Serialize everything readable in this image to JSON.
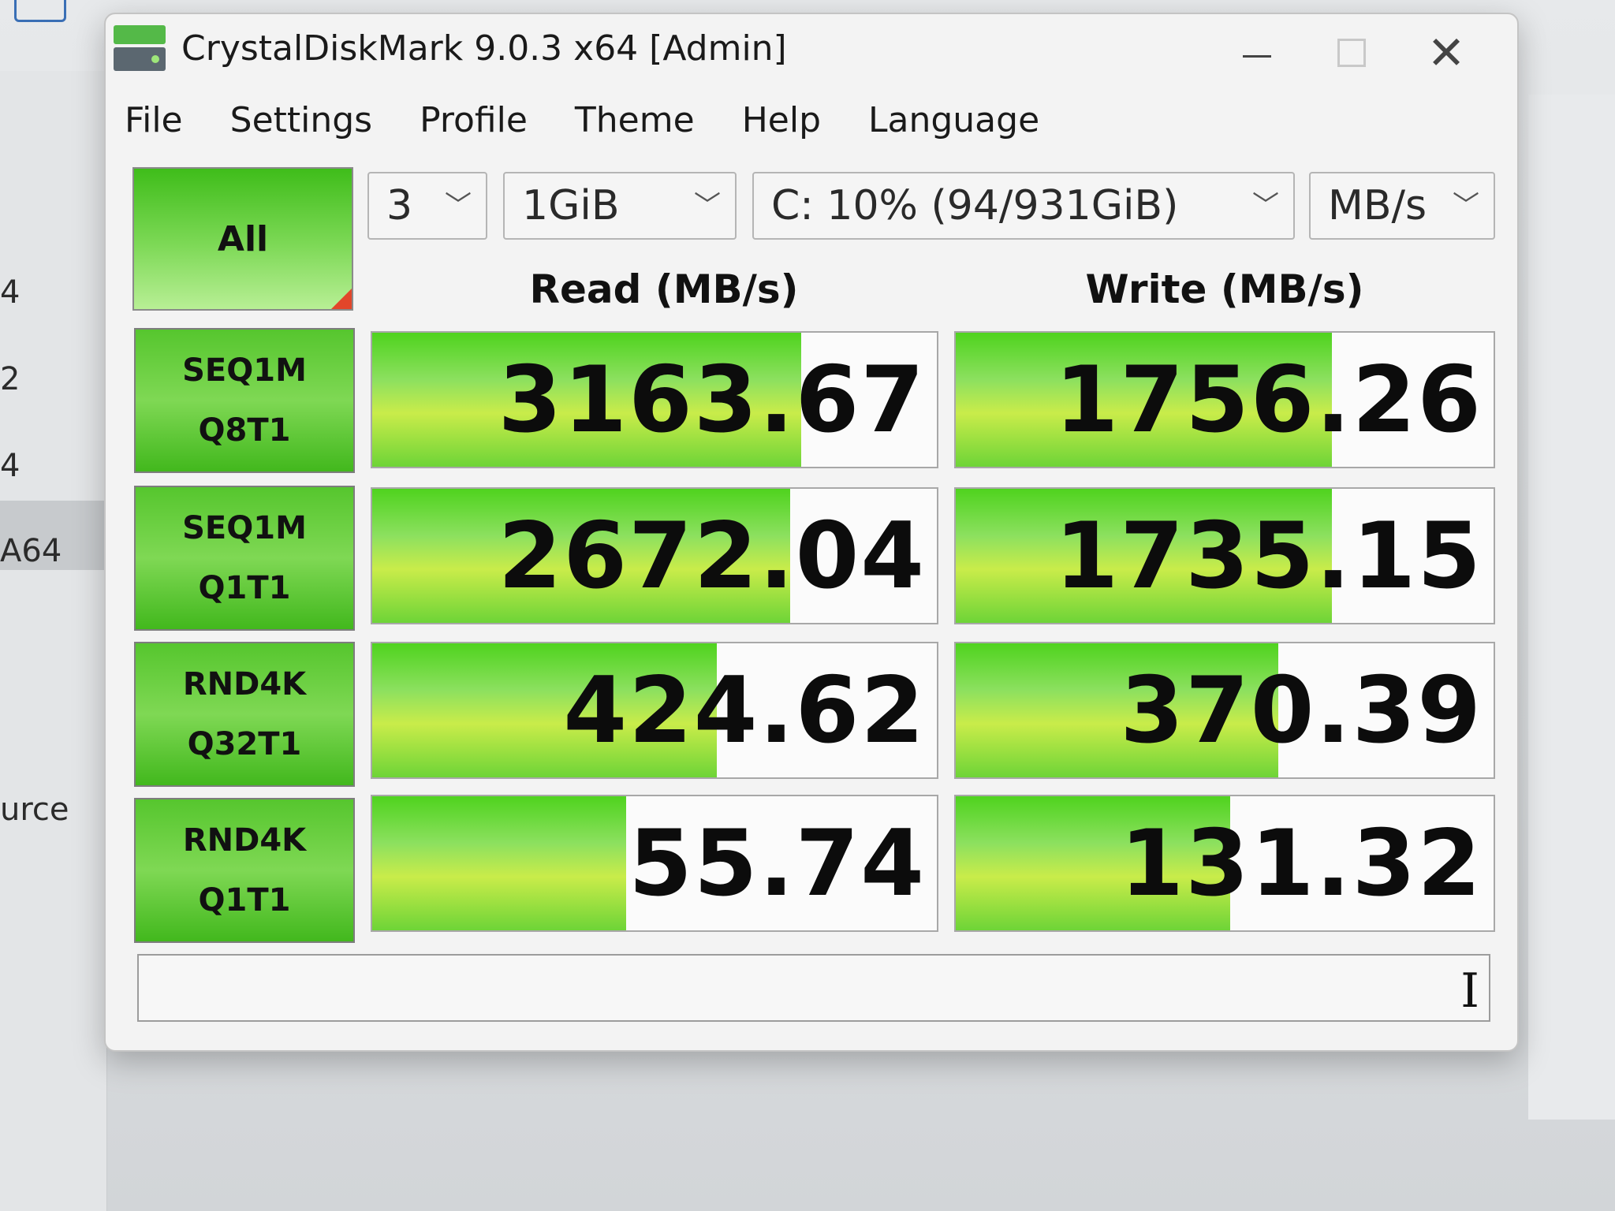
{
  "window": {
    "title": "CrystalDiskMark 9.0.3 x64 [Admin]"
  },
  "menu": [
    "File",
    "Settings",
    "Profile",
    "Theme",
    "Help",
    "Language"
  ],
  "controls": {
    "all_label": "All",
    "count": "3",
    "size": "1GiB",
    "drive": "C: 10% (94/931GiB)",
    "unit": "MB/s"
  },
  "headers": {
    "read": "Read (MB/s)",
    "write": "Write (MB/s)"
  },
  "tests": [
    {
      "line1": "SEQ1M",
      "line2": "Q8T1",
      "read": "3163.67",
      "write": "1756.26",
      "read_fill": 0.76,
      "write_fill": 0.7
    },
    {
      "line1": "SEQ1M",
      "line2": "Q1T1",
      "read": "2672.04",
      "write": "1735.15",
      "read_fill": 0.74,
      "write_fill": 0.7
    },
    {
      "line1": "RND4K",
      "line2": "Q32T1",
      "read": "424.62",
      "write": "370.39",
      "read_fill": 0.61,
      "write_fill": 0.6
    },
    {
      "line1": "RND4K",
      "line2": "Q1T1",
      "read": "55.74",
      "write": "131.32",
      "read_fill": 0.45,
      "write_fill": 0.51
    }
  ],
  "comment": "",
  "background_fragments": [
    "4",
    "2",
    "4",
    "A64",
    "urce"
  ],
  "colors": {
    "bar_green": "#6ed437",
    "button_green": "#56c62e",
    "corner_red": "#e2462a"
  }
}
